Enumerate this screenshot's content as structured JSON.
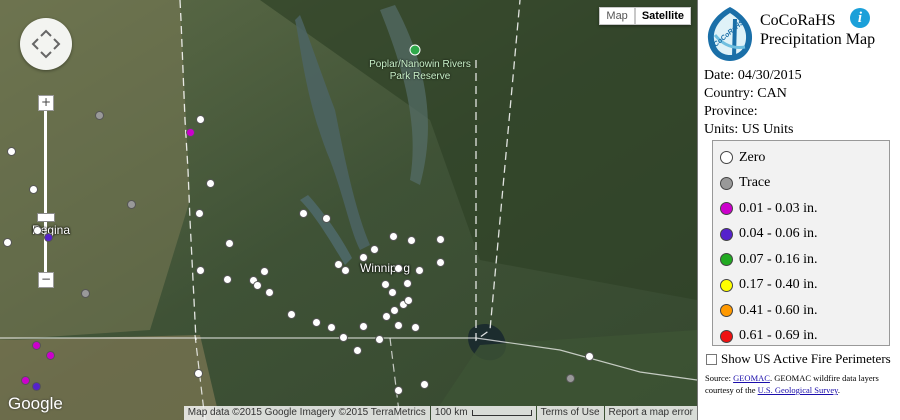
{
  "map": {
    "type_buttons": [
      "Map",
      "Satellite"
    ],
    "active_type": "Satellite",
    "zoom_in": "+",
    "zoom_out": "−",
    "place_labels": {
      "regina": "Regina",
      "winnipeg": "Winnipeg",
      "park": "Poplar/Nanowin Rivers Park Reserve"
    },
    "google_logo": "Google",
    "attribution": "Map data ©2015 Google Imagery ©2015 TerraMetrics",
    "scale": "100 km",
    "terms": "Terms of Use",
    "report": "Report a map error"
  },
  "panel": {
    "logo_text": "CoCoRaHS",
    "title_line1": "CoCoRaHS",
    "title_line2": "Precipitation Map",
    "info_icon": "i",
    "date": "Date: 04/30/2015",
    "country": "Country: CAN",
    "province": "Province:",
    "units": "Units: US Units",
    "legend": [
      {
        "label": "Zero",
        "color": "#ffffff"
      },
      {
        "label": "Trace",
        "color": "#999999"
      },
      {
        "label": "0.01 - 0.03 in.",
        "color": "#cc00cc"
      },
      {
        "label": "0.04 - 0.06 in.",
        "color": "#5522cc"
      },
      {
        "label": "0.07 - 0.16 in.",
        "color": "#22aa22"
      },
      {
        "label": "0.17 - 0.40 in.",
        "color": "#ffff00"
      },
      {
        "label": "0.41 - 0.60 in.",
        "color": "#ff9900"
      },
      {
        "label": "0.61 - 0.69 in.",
        "color": "#ee1111"
      }
    ],
    "fire_label": "Show US Active Fire Perimeters",
    "source_prefix": "Source: ",
    "source_link": "GEOMAC",
    "source_mid": ". GEOMAC wildfire data layers courtesy of the ",
    "source_link2": "U.S. Geological Survey",
    "source_end": "."
  },
  "colors": {
    "zero": "#ffffff",
    "trace": "#999999",
    "magenta": "#cc00cc",
    "purple": "#5522cc"
  }
}
